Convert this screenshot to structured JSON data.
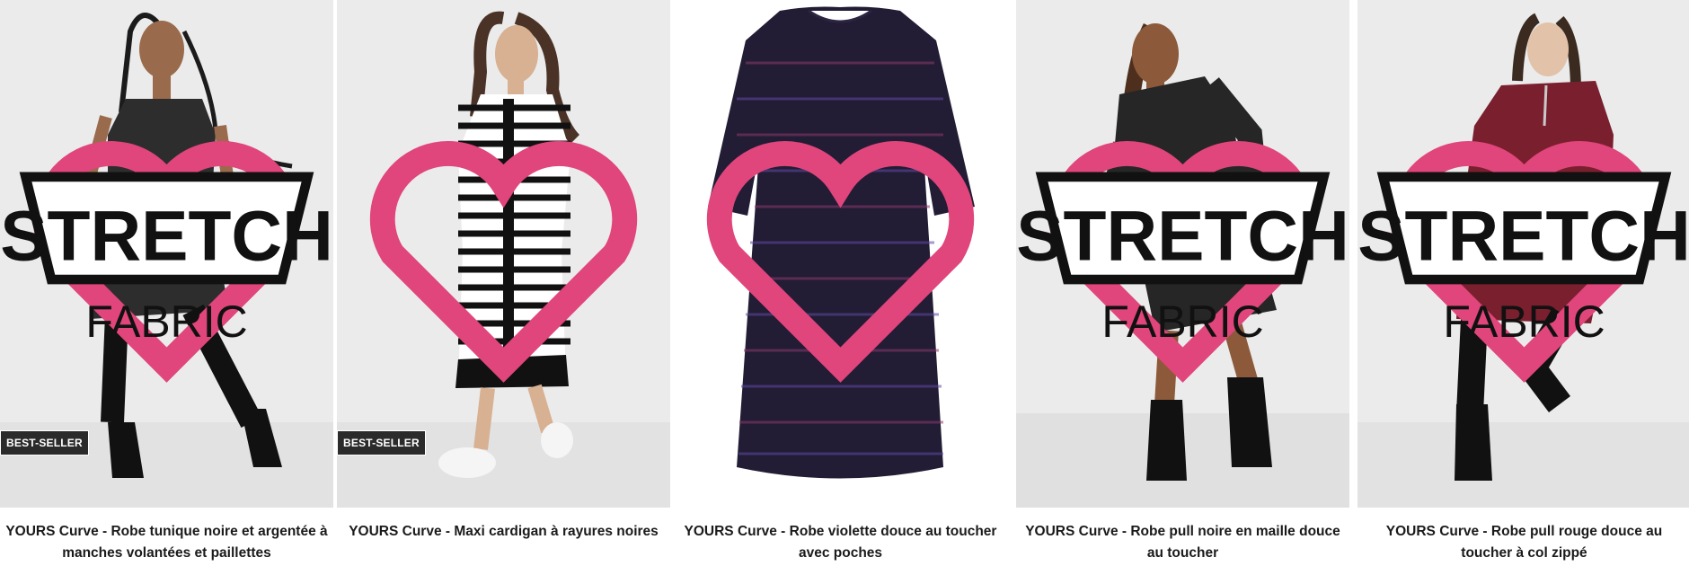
{
  "products": [
    {
      "title": "YOURS Curve - Robe tunique noire et argentée à manches volantées et paillettes",
      "badge": "BEST-SELLER",
      "stretch_label": "STRETCH",
      "stretch_sub": "FABRIC",
      "icon": "heart-outline-icon"
    },
    {
      "title": "YOURS Curve - Maxi cardigan à rayures noires",
      "badge": "BEST-SELLER",
      "icon": "heart-outline-icon"
    },
    {
      "title": "YOURS Curve - Robe violette douce au toucher avec poches",
      "icon": "heart-outline-icon"
    },
    {
      "title": "YOURS Curve - Robe pull noire en maille douce au toucher",
      "stretch_label": "STRETCH",
      "stretch_sub": "FABRIC",
      "icon": "heart-outline-icon"
    },
    {
      "title": "YOURS Curve - Robe pull rouge douce au toucher à col zippé",
      "stretch_label": "STRETCH",
      "stretch_sub": "FABRIC",
      "icon": "heart-outline-icon"
    }
  ],
  "colors": {
    "heart": "#e0457b",
    "badge_bg": "#2b2b2b",
    "photo_bg": "#ebebeb"
  }
}
